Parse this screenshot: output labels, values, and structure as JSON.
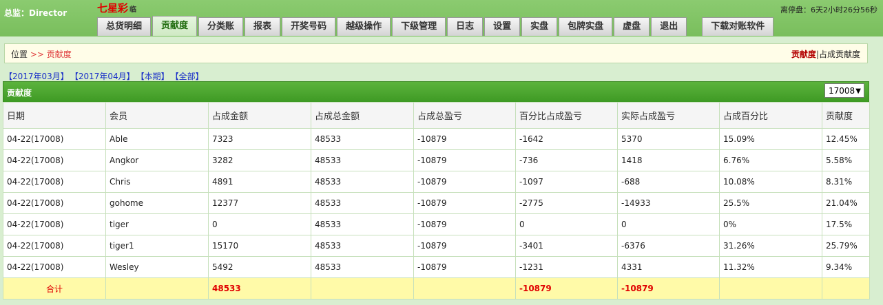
{
  "header": {
    "user_label": "总监：Director",
    "brand": "七星彩",
    "brand_sub": "临",
    "countdown": "离停盘：6天2小时26分56秒"
  },
  "nav": [
    {
      "label": "总货明细",
      "active": false
    },
    {
      "label": "贡献度",
      "active": true
    },
    {
      "label": "分类账",
      "active": false
    },
    {
      "label": "报表",
      "active": false
    },
    {
      "label": "开奖号码",
      "active": false
    },
    {
      "label": "越级操作",
      "active": false
    },
    {
      "label": "下级管理",
      "active": false
    },
    {
      "label": "日志",
      "active": false
    },
    {
      "label": "设置",
      "active": false
    },
    {
      "label": "实盘",
      "active": false
    },
    {
      "label": "包牌实盘",
      "active": false
    },
    {
      "label": "虚盘",
      "active": false
    },
    {
      "label": "退出",
      "active": false
    }
  ],
  "nav_download": "下载对账软件",
  "position": {
    "label": "位置",
    "arrow": ">>",
    "current": "贡献度",
    "right_active": "贡献度",
    "right_sep": "|",
    "right_other": "占成贡献度"
  },
  "periods": [
    "【2017年03月】",
    "【2017年04月】",
    "【本期】",
    "【全部】"
  ],
  "panel": {
    "title": "贡献度",
    "select_value": "17008"
  },
  "table": {
    "columns": [
      "日期",
      "会员",
      "占成金额",
      "占成总金额",
      "占成总盈亏",
      "百分比占成盈亏",
      "实际占成盈亏",
      "占成百分比",
      "贡献度"
    ],
    "rows": [
      [
        "04-22(17008)",
        "Able",
        "7323",
        "48533",
        "-10879",
        "-1642",
        "5370",
        "15.09%",
        "12.45%"
      ],
      [
        "04-22(17008)",
        "Angkor",
        "3282",
        "48533",
        "-10879",
        "-736",
        "1418",
        "6.76%",
        "5.58%"
      ],
      [
        "04-22(17008)",
        "Chris",
        "4891",
        "48533",
        "-10879",
        "-1097",
        "-688",
        "10.08%",
        "8.31%"
      ],
      [
        "04-22(17008)",
        "gohome",
        "12377",
        "48533",
        "-10879",
        "-2775",
        "-14933",
        "25.5%",
        "21.04%"
      ],
      [
        "04-22(17008)",
        "tiger",
        "0",
        "48533",
        "-10879",
        "0",
        "0",
        "0%",
        "17.5%"
      ],
      [
        "04-22(17008)",
        "tiger1",
        "15170",
        "48533",
        "-10879",
        "-3401",
        "-6376",
        "31.26%",
        "25.79%"
      ],
      [
        "04-22(17008)",
        "Wesley",
        "5492",
        "48533",
        "-10879",
        "-1231",
        "4331",
        "11.32%",
        "9.34%"
      ]
    ],
    "total": {
      "label": "合计",
      "amount": "48533",
      "pct_profit": "-10879",
      "actual_profit": "-10879"
    }
  }
}
